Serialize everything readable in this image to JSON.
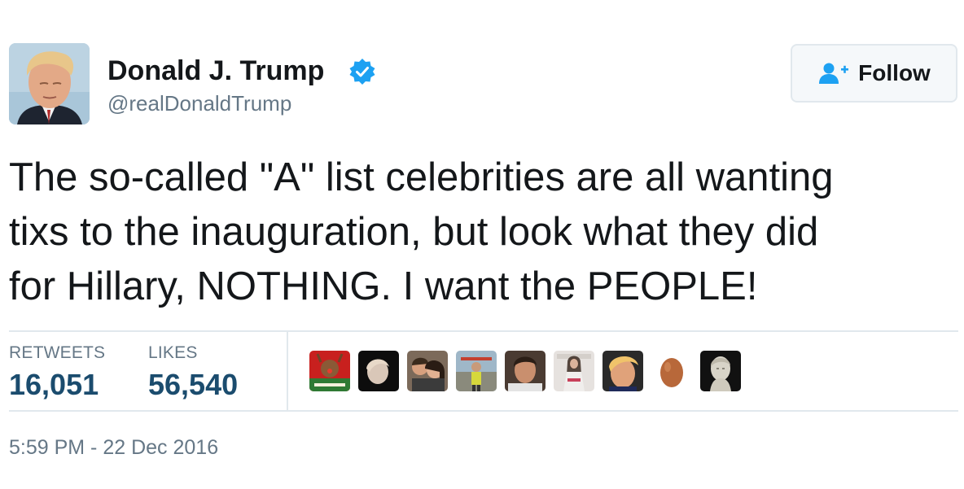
{
  "author": {
    "name": "Donald J. Trump",
    "handle": "@realDonaldTrump",
    "verified": true,
    "avatar_icon": "profile-photo"
  },
  "follow_button": {
    "label": "Follow",
    "icon": "add-user-icon"
  },
  "tweet": {
    "text": "The so-called \"A\" list celebrities are all wanting\ntixs to the inauguration, but look what they did\nfor Hillary, NOTHING. I want the PEOPLE!"
  },
  "stats": {
    "retweets_label": "RETWEETS",
    "retweets_value": "16,051",
    "likes_label": "LIKES",
    "likes_value": "56,540"
  },
  "liked_by": [
    {
      "icon": "christmas-photo-avatar"
    },
    {
      "icon": "dark-portrait-avatar"
    },
    {
      "icon": "couple-photo-avatar"
    },
    {
      "icon": "outdoor-photo-avatar"
    },
    {
      "icon": "man-portrait-avatar"
    },
    {
      "icon": "woman-portrait-avatar"
    },
    {
      "icon": "caricature-avatar"
    },
    {
      "icon": "default-egg-avatar"
    },
    {
      "icon": "statue-bust-avatar"
    }
  ],
  "timestamp": "5:59 PM - 22 Dec 2016",
  "colors": {
    "accent": "#1da1f2",
    "stat_value": "#1b4c6e",
    "muted": "#657786",
    "divider": "#e1e8ed"
  }
}
